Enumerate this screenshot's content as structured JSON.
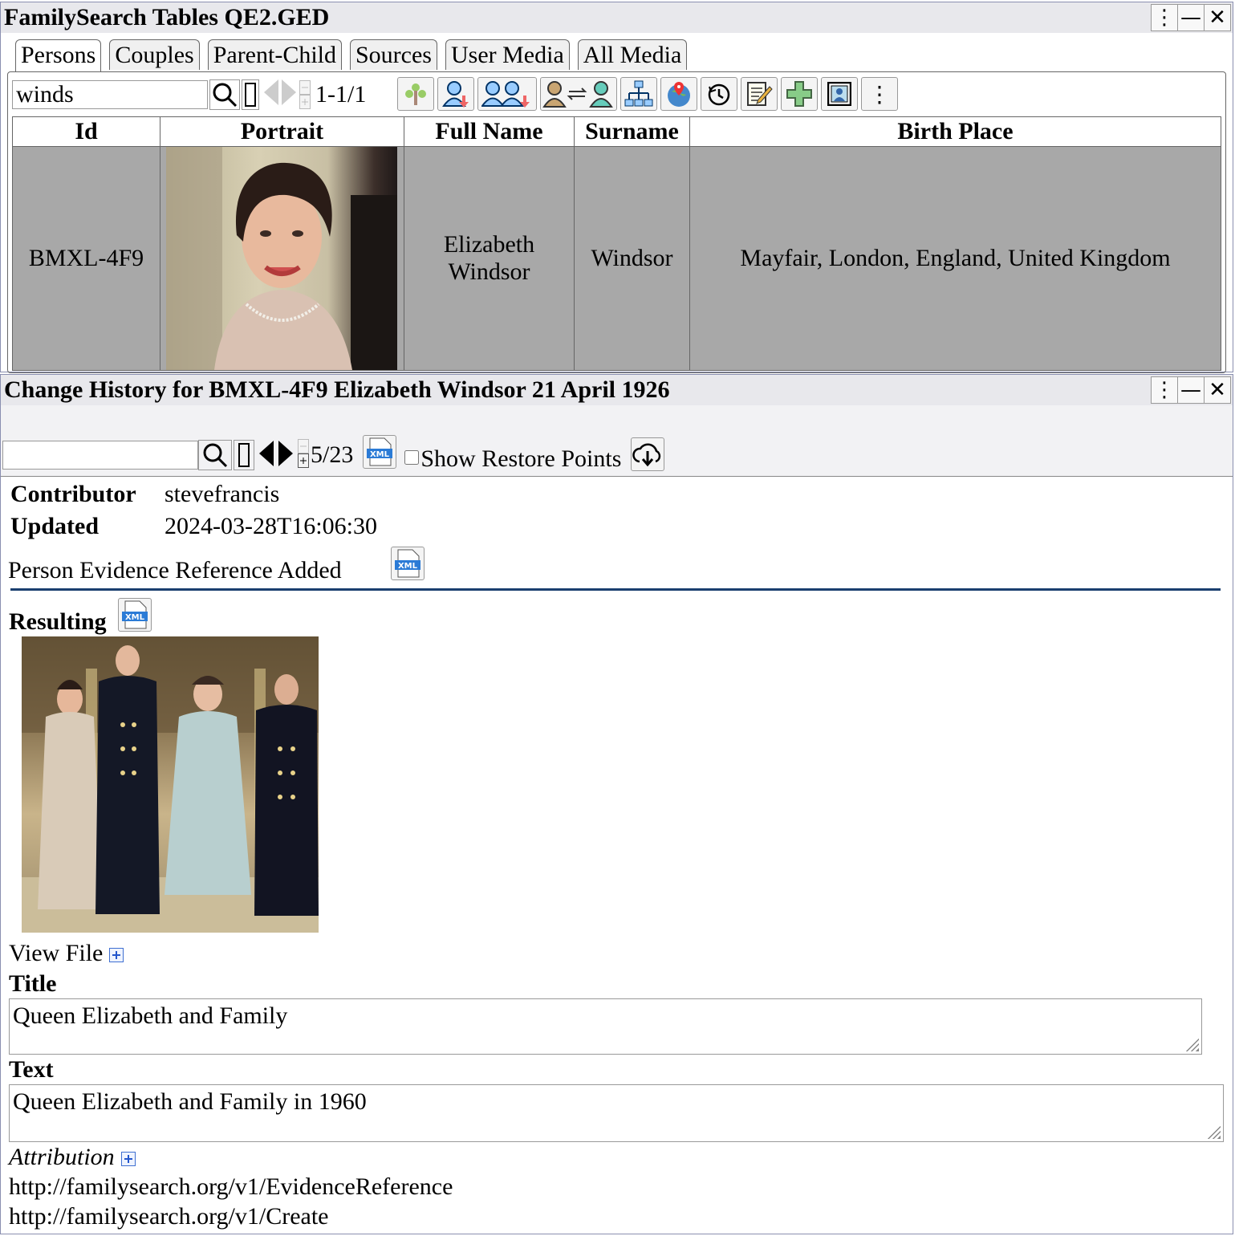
{
  "top_window": {
    "title": "FamilySearch Tables QE2.GED",
    "tabs": [
      "Persons",
      "Couples",
      "Parent-Child",
      "Sources",
      "User Media",
      "All Media"
    ],
    "search_value": "winds",
    "counter": "1-1/1",
    "columns": [
      "Id",
      "Portrait",
      "Full Name",
      "Surname",
      "Birth Place"
    ],
    "row": {
      "id": "BMXL-4F9",
      "full_name_line1": "Elizabeth",
      "full_name_line2": "Windsor",
      "surname": "Windsor",
      "birth_place": "Mayfair, London, England, United Kingdom"
    }
  },
  "history_window": {
    "title": "Change History for BMXL-4F9 Elizabeth Windsor 21 April 1926",
    "search_value": "",
    "counter": "5/23",
    "show_restore_points_label": "Show Restore Points",
    "contributor_label": "Contributor",
    "contributor_value": "stevefrancis",
    "updated_label": "Updated",
    "updated_value": "2024-03-28T16:06:30",
    "change_description": "Person Evidence Reference Added",
    "resulting_label": "Resulting",
    "view_file_label": "View File",
    "title_label": "Title",
    "title_value": "Queen Elizabeth and Family",
    "text_label": "Text",
    "text_value": "Queen Elizabeth and Family in 1960",
    "attribution_label": "Attribution",
    "attribution_links": [
      "http://familysearch.org/v1/EvidenceReference",
      "http://familysearch.org/v1/Create"
    ]
  },
  "colors": {
    "row_selected": "#a8a8a8",
    "divider": "#1a3f6f",
    "titlebar": "#e8e8ec"
  }
}
